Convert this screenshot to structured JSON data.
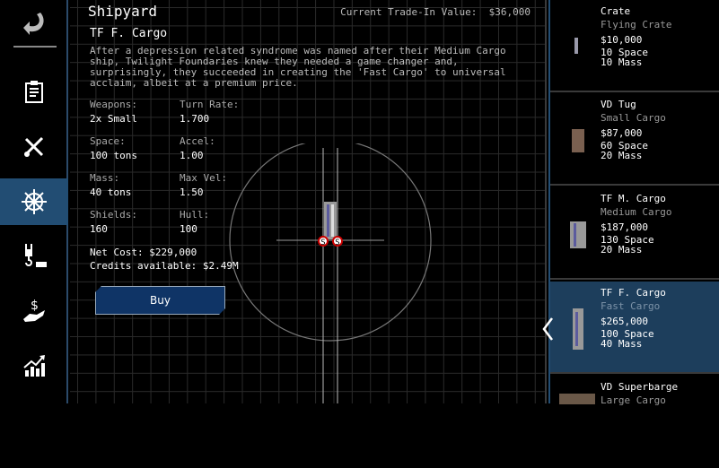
{
  "sidebar": {
    "items": [
      {
        "icon": "back-arrow-icon"
      },
      {
        "icon": "clipboard-icon"
      },
      {
        "icon": "tools-icon"
      },
      {
        "icon": "ship-wheel-icon",
        "selected": true
      },
      {
        "icon": "crane-cargo-icon"
      },
      {
        "icon": "hand-dollar-icon"
      },
      {
        "icon": "growth-chart-icon"
      }
    ]
  },
  "header": {
    "title": "Shipyard",
    "trade_in": "Current Trade-In Value:  $36,000"
  },
  "ship": {
    "name": "TF F. Cargo",
    "description": "After a depression related syndrome was named after their Medium Cargo ship, Twilight Foundaries knew they needed a game changer and, surprisingly, they succeeded in creating the 'Fast Cargo' to universal acclaim, albeit at a premium price.",
    "stats": [
      {
        "label": "Weapons:",
        "value": "2x Small"
      },
      {
        "label": "Turn Rate:",
        "value": "1.700"
      },
      {
        "label": "Space:",
        "value": "100 tons"
      },
      {
        "label": "Accel:",
        "value": "1.00"
      },
      {
        "label": "Mass:",
        "value": "40 tons"
      },
      {
        "label": "Max Vel:",
        "value": "1.50"
      },
      {
        "label": "Shields:",
        "value": "160"
      },
      {
        "label": "Hull:",
        "value": "100"
      }
    ],
    "net_cost": "Net Cost: $229,000",
    "credits": "Credits available: $2.49M",
    "hardpoint_label": "S"
  },
  "buy_label": "Buy",
  "list": [
    {
      "name": "Crate",
      "class": "Flying Crate",
      "price": "$10,000",
      "space": "10 Space",
      "mass": "10 Mass"
    },
    {
      "name": "VD Tug",
      "class": "Small Cargo",
      "price": "$87,000",
      "space": "60 Space",
      "mass": "20 Mass"
    },
    {
      "name": "TF M. Cargo",
      "class": "Medium Cargo",
      "price": "$187,000",
      "space": "130 Space",
      "mass": "20 Mass"
    },
    {
      "name": "TF F. Cargo",
      "class": "Fast Cargo",
      "price": "$265,000",
      "space": "100 Space",
      "mass": "40 Mass",
      "selected": true
    },
    {
      "name": "VD Superbarge",
      "class": "Large Cargo"
    }
  ],
  "colors": {
    "accent": "#224d73",
    "button": "#0f3466",
    "selected_item": "#1d3e5c"
  }
}
